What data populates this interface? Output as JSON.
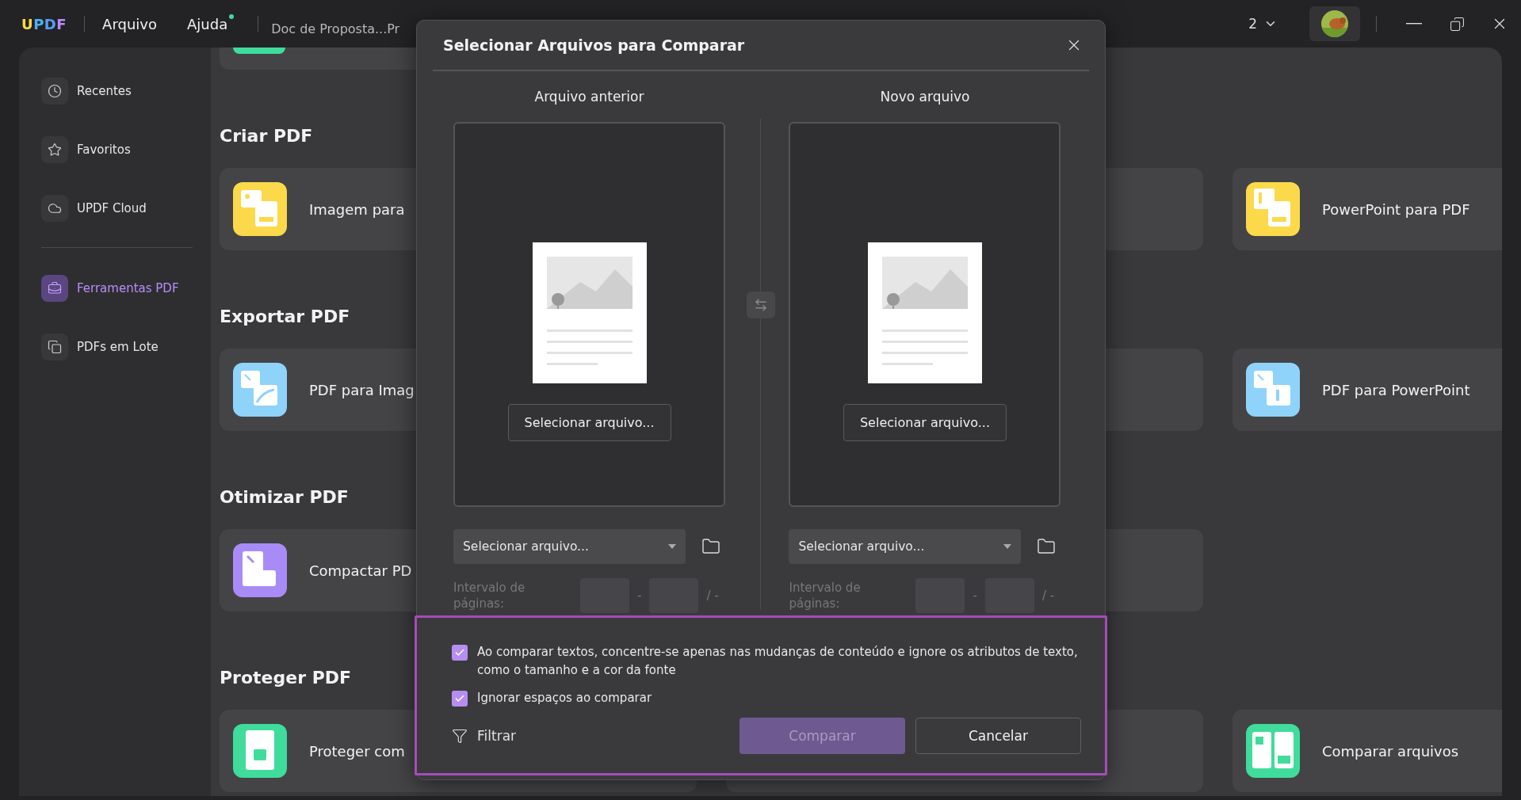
{
  "titlebar": {
    "logo": "UPDF",
    "menu": [
      {
        "label": "Arquivo",
        "badge": false
      },
      {
        "label": "Ajuda",
        "badge": true
      }
    ],
    "tab": "Doc de Proposta...Pr",
    "window_count": "2"
  },
  "sidebar": {
    "items": [
      {
        "label": "Recentes",
        "kind": "clock",
        "selected": false
      },
      {
        "label": "Favoritos",
        "kind": "star",
        "selected": false
      },
      {
        "label": "UPDF Cloud",
        "kind": "cloud",
        "selected": false
      },
      {
        "label": "Ferramentas PDF",
        "kind": "briefcase",
        "selected": true
      },
      {
        "label": "PDFs em Lote",
        "kind": "stack",
        "selected": false
      }
    ]
  },
  "sections": [
    {
      "title": "Criar PDF",
      "cards": [
        {
          "label": "Imagem para",
          "kind": "image-to-pdf",
          "color": "#fcd94a"
        },
        {
          "kind": "blank"
        },
        {
          "label": "PowerPoint para PDF",
          "kind": "ppt-to-pdf",
          "color": "#fcd94a"
        }
      ]
    },
    {
      "title": "Exportar PDF",
      "cards": [
        {
          "label": "PDF para Imag",
          "kind": "pdf-to-image",
          "color": "#8fd3fb"
        },
        {
          "kind": "blank"
        },
        {
          "label": "PDF para PowerPoint",
          "kind": "pdf-to-ppt",
          "color": "#8fd3fb"
        }
      ]
    },
    {
      "title": "Otimizar PDF",
      "cards": [
        {
          "label": "Compactar PD",
          "kind": "compress",
          "color": "#a98bf7"
        },
        {
          "kind": "blank"
        }
      ]
    },
    {
      "title": "Proteger PDF",
      "cards": [
        {
          "label": "Proteger com",
          "kind": "protect",
          "color": "#3fdc9b"
        },
        {
          "kind": "blank"
        },
        {
          "label": "Comparar arquivos",
          "kind": "compare",
          "color": "#3fdc9b"
        }
      ]
    }
  ],
  "dialog": {
    "title": "Selecionar Arquivos para Comparar",
    "columns": [
      {
        "heading": "Arquivo anterior",
        "button": "Selecionar arquivo...",
        "placeholder": "Selecionar arquivo...",
        "range_label": "Intervalo de páginas:",
        "range_sep": "-",
        "range_total": "/ -"
      },
      {
        "heading": "Novo arquivo",
        "button": "Selecionar arquivo...",
        "placeholder": "Selecionar arquivo...",
        "range_label": "Intervalo de páginas:",
        "range_sep": "-",
        "range_total": "/ -"
      }
    ],
    "options": [
      {
        "label": "Ao comparar textos, concentre-se apenas nas mudanças de conteúdo e ignore os atributos de texto, como o tamanho e a cor da fonte",
        "checked": true
      },
      {
        "label": "Ignorar espaços ao comparar",
        "checked": true
      }
    ],
    "filter": "Filtrar",
    "buttons": [
      {
        "label": "Comparar",
        "kind": "primary",
        "disabled": true
      },
      {
        "label": "Cancelar",
        "kind": "secondary",
        "disabled": false
      }
    ]
  }
}
